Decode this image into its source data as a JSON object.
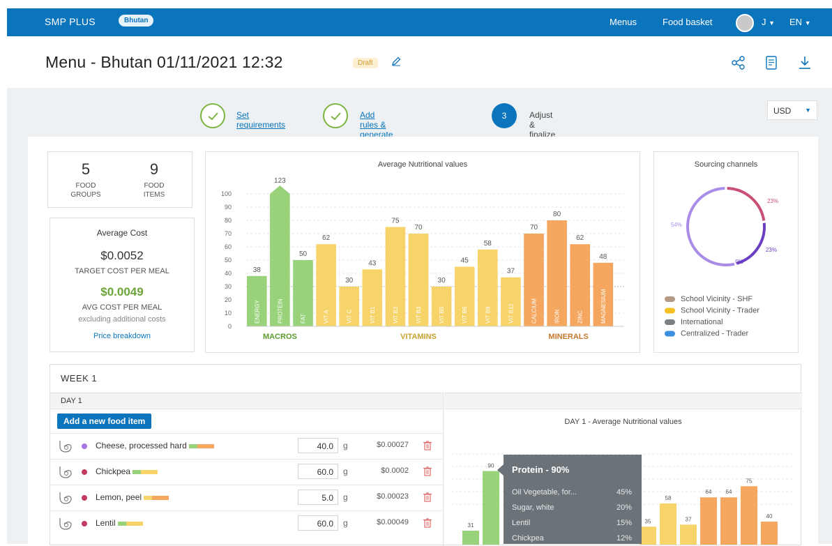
{
  "header": {
    "brand": "SMP PLUS",
    "country": "Bhutan",
    "nav": [
      "Menus",
      "Food basket"
    ],
    "user": "J",
    "language": "EN"
  },
  "page": {
    "title": "Menu - Bhutan 01/11/2021 12:32",
    "status": "Draft"
  },
  "stepper": {
    "steps": [
      {
        "label": "Set requirements",
        "state": "done"
      },
      {
        "label": "Add rules & generate menu",
        "state": "done"
      },
      {
        "number": "3",
        "label": "Adjust & finalize the menu",
        "state": "active"
      }
    ],
    "currency": "USD"
  },
  "stats": {
    "food_groups": {
      "value": "5",
      "label": "FOOD GROUPS"
    },
    "food_items": {
      "value": "9",
      "label": "FOOD ITEMS"
    }
  },
  "cost": {
    "title": "Average Cost",
    "target_value": "$0.0052",
    "target_label": "TARGET COST PER MEAL",
    "avg_value": "$0.0049",
    "avg_label": "AVG COST PER MEAL",
    "note": "excluding additional costs",
    "link": "Price breakdown"
  },
  "chart_data": [
    {
      "type": "bar",
      "title": "Average Nutritional values",
      "categories": [
        "ENERGY",
        "PROTEIN",
        "FAT",
        "VIT A",
        "VIT C",
        "VIT B1",
        "VIT B2",
        "VIT B3",
        "VIT B5",
        "VIT B6",
        "VIT B9",
        "VIT B12",
        "CALCIUM",
        "IRON",
        "ZINC",
        "MAGNESIUM"
      ],
      "values": [
        38,
        123,
        50,
        62,
        30,
        43,
        75,
        70,
        30,
        45,
        58,
        37,
        70,
        80,
        62,
        48
      ],
      "groups": [
        {
          "name": "MACROS",
          "categories": [
            "ENERGY",
            "PROTEIN",
            "FAT"
          ],
          "color": "#98d27a",
          "label_color": "#5c9a2d"
        },
        {
          "name": "VITAMINS",
          "categories": [
            "VIT A",
            "VIT C",
            "VIT B1",
            "VIT B2",
            "VIT B3",
            "VIT B5",
            "VIT B6",
            "VIT B9",
            "VIT B12"
          ],
          "color": "#f7d46a",
          "label_color": "#c9a22e"
        },
        {
          "name": "MINERALS",
          "categories": [
            "CALCIUM",
            "IRON",
            "ZINC",
            "MAGNESIUM"
          ],
          "color": "#f5a760",
          "label_color": "#c5782e"
        }
      ],
      "yticks": [
        0,
        10,
        20,
        30,
        40,
        50,
        60,
        70,
        80,
        90,
        100
      ],
      "ylim": [
        0,
        100
      ],
      "reference_line": 30
    },
    {
      "type": "pie",
      "title": "Sourcing channels",
      "slices": [
        {
          "label": "54%",
          "value": 54,
          "color": "#a98ce8"
        },
        {
          "label": "23%",
          "value": 23,
          "color": "#c94f74"
        },
        {
          "label": "23%",
          "value": 23,
          "color": "#6b3fc4"
        },
        {
          "label": "0%",
          "value": 0,
          "color": "#6b3fc4"
        }
      ],
      "legend": [
        {
          "label": "School Vicinity - SHF",
          "color": "#b59a86"
        },
        {
          "label": "School Vicinity - Trader",
          "color": "#f5c026"
        },
        {
          "label": "International",
          "color": "#7a7f84"
        },
        {
          "label": "Centralized - Trader",
          "color": "#3d8fe0"
        }
      ]
    },
    {
      "type": "bar",
      "title": "DAY 1 - Average Nutritional values",
      "visible_values": [
        31,
        90,
        35,
        58,
        37,
        64,
        64,
        75,
        40
      ]
    }
  ],
  "week": {
    "title": "WEEK 1",
    "day": "DAY 1",
    "add_button": "Add a new food item",
    "unit": "g",
    "items": [
      {
        "name": "Cheese, processed  hard",
        "dot": "#a777e0",
        "bars": [
          "#98d27a",
          "#f5a760"
        ],
        "qty": "40.0",
        "cost": "$0.00027"
      },
      {
        "name": "Chickpea",
        "dot": "#c23a60",
        "bars": [
          "#98d27a",
          "#f7d46a"
        ],
        "qty": "60.0",
        "cost": "$0.0002"
      },
      {
        "name": "Lemon, peel",
        "dot": "#c23a60",
        "bars": [
          "#f7d46a",
          "#f5a760"
        ],
        "qty": "5.0",
        "cost": "$0.00023"
      },
      {
        "name": "Lentil",
        "dot": "#c23a60",
        "bars": [
          "#98d27a",
          "#f7d46a"
        ],
        "qty": "60.0",
        "cost": "$0.00049"
      }
    ]
  },
  "tooltip": {
    "title": "Protein  -  90%",
    "rows": [
      {
        "name": "Oil Vegetable, for...",
        "value": "45%"
      },
      {
        "name": "Sugar, white",
        "value": "20%"
      },
      {
        "name": "Lentil",
        "value": "15%"
      },
      {
        "name": "Chickpea",
        "value": "12%"
      }
    ]
  }
}
